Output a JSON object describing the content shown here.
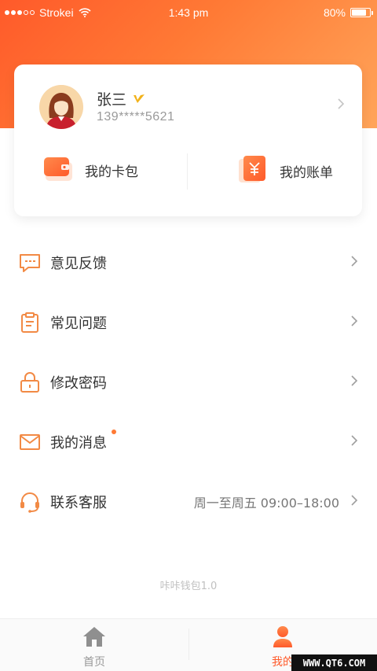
{
  "status_bar": {
    "carrier": "Strokei",
    "time": "1:43 pm",
    "battery_percent": "80%",
    "battery_level": 0.8
  },
  "profile": {
    "name": "张三",
    "phone": "139*****5621",
    "vip_icon": "v-badge-icon",
    "actions": [
      {
        "label": "我的卡包",
        "icon": "wallet-icon"
      },
      {
        "label": "我的账单",
        "icon": "bill-icon"
      }
    ]
  },
  "menu": {
    "items": [
      {
        "label": "意见反馈",
        "icon": "feedback-icon"
      },
      {
        "label": "常见问题",
        "icon": "clipboard-icon"
      },
      {
        "label": "修改密码",
        "icon": "lock-icon"
      },
      {
        "label": "我的消息",
        "icon": "mail-icon",
        "badge": true
      },
      {
        "label": "联系客服",
        "icon": "headset-icon",
        "extra": "周一至周五 09:00–18:00"
      }
    ]
  },
  "version": "咔咔钱包1.0",
  "tabbar": {
    "tabs": [
      {
        "label": "首页",
        "icon": "home-icon"
      },
      {
        "label": "我的",
        "icon": "user-icon",
        "active": true
      }
    ]
  },
  "watermark": "WWW.QT6.COM",
  "colors": {
    "accent": "#ff5a2a",
    "accent_light": "#ffa55a",
    "icon_orange": "#f28a45"
  }
}
